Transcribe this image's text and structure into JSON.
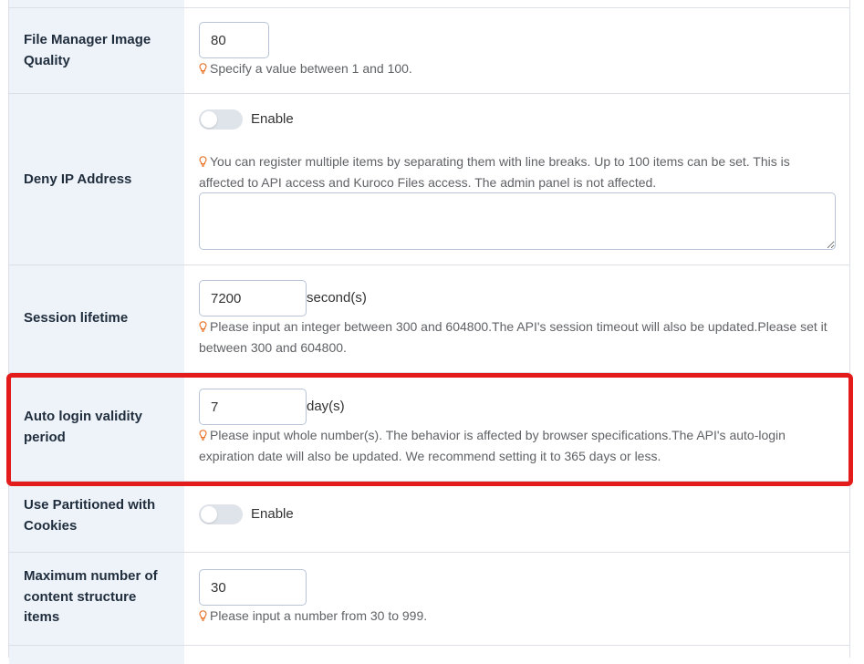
{
  "rows": {
    "image_quality": {
      "label": "File Manager Image Quality",
      "value": "80",
      "hint": "Specify a value between 1 and 100."
    },
    "deny_ip": {
      "label": "Deny IP Address",
      "toggle_label": "Enable",
      "toggle_on": false,
      "hint": "You can register multiple items by separating them with line breaks. Up to 100 items can be set. This is affected to API access and Kuroco Files access. The admin panel is not affected.",
      "textarea_value": ""
    },
    "session_lifetime": {
      "label": "Session lifetime",
      "value": "7200",
      "unit": "second(s)",
      "hint": "Please input an integer between 300 and 604800.The API's session timeout will also be updated.Please set it between 300 and 604800."
    },
    "auto_login": {
      "label": "Auto login validity period",
      "value": "7",
      "unit": "day(s)",
      "hint": "Please input whole number(s). The behavior is affected by browser specifications.The API's auto-login expiration date will also be updated. We recommend setting it to 365 days or less."
    },
    "partitioned_cookies": {
      "label": "Use Partitioned with Cookies",
      "toggle_label": "Enable",
      "toggle_on": false
    },
    "max_content_structure": {
      "label": "Maximum number of content structure items",
      "value": "30",
      "hint": "Please input a number from 30 to 999."
    }
  },
  "icons": {
    "hint": "lightbulb-icon"
  },
  "colors": {
    "hint_icon": "#e8762c",
    "highlight": "#e31b1b",
    "label_bg": "#eef3f9"
  }
}
